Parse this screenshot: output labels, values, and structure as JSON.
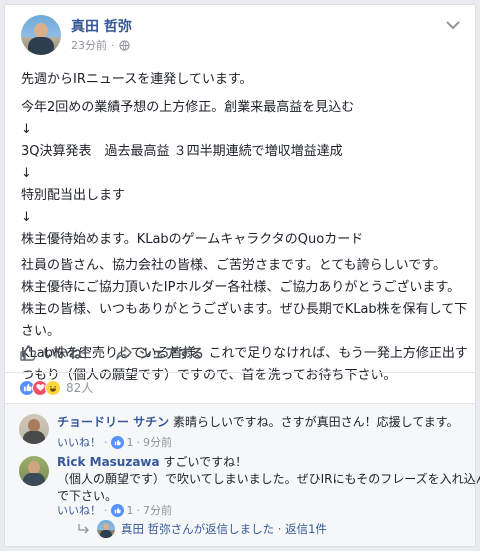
{
  "post": {
    "author": "真田 哲弥",
    "time": "23分前",
    "separator": "·",
    "lines": [
      "先週からIRニュースを連発しています。",
      "今年2回めの業績予想の上方修正。創業来最高益を見込む",
      "↓",
      "3Q決算発表　過去最高益 ３四半期連続で増収増益達成",
      "↓",
      "特別配当出します",
      "↓",
      "株主優待始めます。KLabのゲームキャラクタのQuoカード"
    ],
    "para2": [
      "社員の皆さん、協力会社の皆様、ご苦労さまです。とても誇らしいです。",
      "株主優待にご協力頂いたIPホルダー各社様、ご協力ありがとうございます。",
      "株主の皆様、いつもありがとうございます。ぜひ長期でKLab株を保有して下",
      "さい。",
      "KLab株を空売りしている皆様、これで足りなければ、もう一発上方修正出す",
      "つもり（個人の願望です）ですので、首を洗ってお待ち下さい。"
    ]
  },
  "actions": {
    "like_label": "いいね！",
    "share_label": "シェアする",
    "like_icon": "thumbs-up-icon",
    "share_icon": "share-arrow-icon"
  },
  "reactions": {
    "count": "82人",
    "colors": {
      "like": "#5890ff",
      "love": "#f25268",
      "haha": "#fcd53f"
    }
  },
  "comments": [
    {
      "name": "チョードリー サチン",
      "text": "素晴らしいですね。さすが真田さん！応援してます。",
      "like_label": "いいね！",
      "like_count": "1",
      "dot": "·",
      "time": "9分前"
    },
    {
      "name": "Rick Masuzawa",
      "text_lines": [
        "すごいですね！",
        "（個人の願望です）で吹いてしまいました。ぜひIRにもそのフレーズを入れ込ん",
        "で下さい。"
      ],
      "like_label": "いいね！",
      "like_count": "1",
      "dot": "·",
      "time": "7分前"
    }
  ],
  "reply": {
    "text": "真田 哲弥さんが返信しました · 返信1件"
  },
  "colors": {
    "link": "#365899",
    "muted": "#90949c",
    "text": "#1d2129"
  }
}
